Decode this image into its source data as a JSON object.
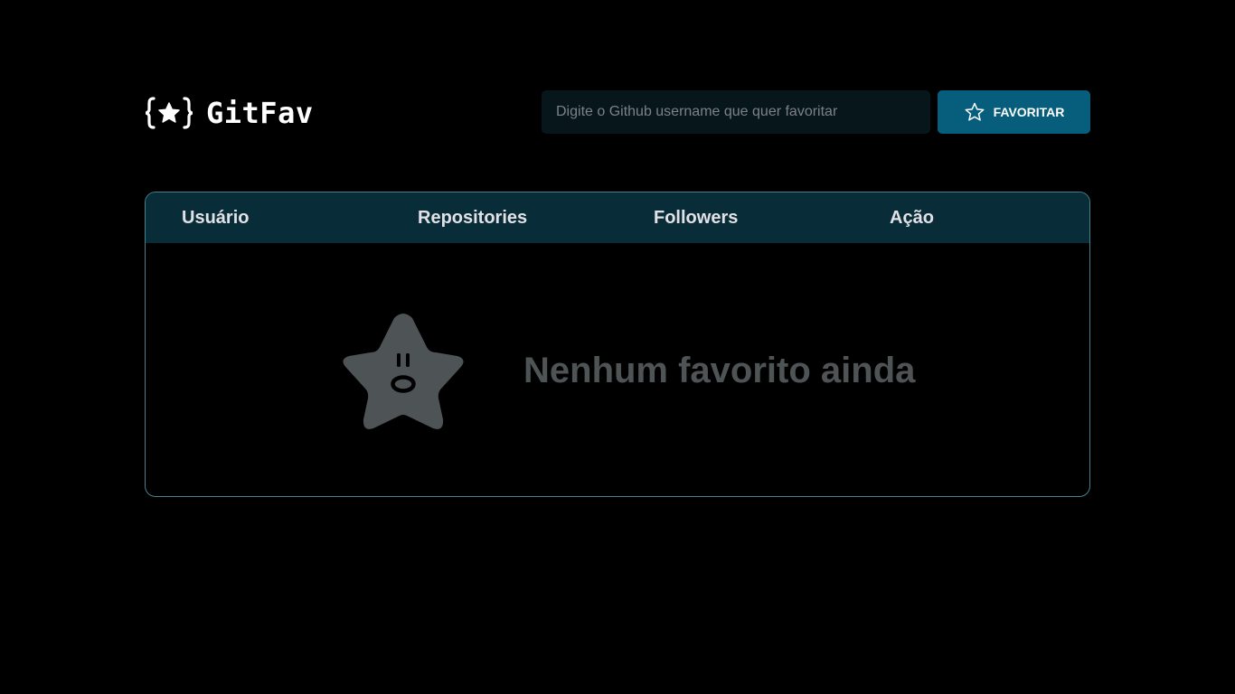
{
  "header": {
    "logo_text": "GitFav",
    "search": {
      "placeholder": "Digite o Github username que quer favoritar",
      "value": ""
    },
    "favorite_button_label": "FAVORITAR"
  },
  "table": {
    "columns": [
      "Usuário",
      "Repositories",
      "Followers",
      "Ação"
    ],
    "rows": []
  },
  "empty_state": {
    "message": "Nenhum favorito ainda",
    "icon": "sad-star-icon"
  },
  "colors": {
    "background": "#000000",
    "accent": "#065e7c",
    "table_header": "#092d38",
    "border": "#4a808c",
    "muted_text": "#4e5455"
  }
}
